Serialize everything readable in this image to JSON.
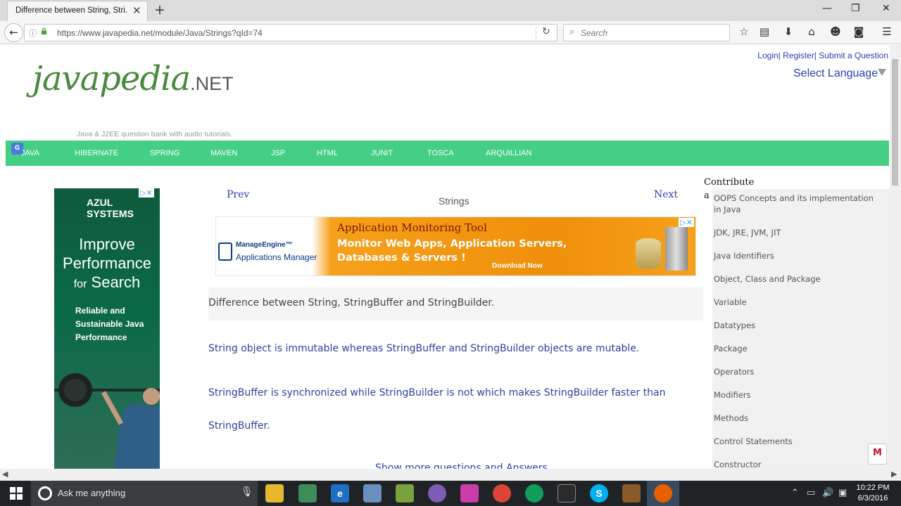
{
  "browser": {
    "tab_title": "Difference between String, Stri...",
    "url": "https://www.javapedia.net/module/Java/Strings?qId=74",
    "search_placeholder": "Search"
  },
  "header": {
    "auth_links": [
      "Login|",
      "Register|",
      "Submit a Question"
    ],
    "select_language": "Select Language",
    "logo_main": "javapedia",
    "logo_suffix": ".NET",
    "tagline": "Java & J2EE question bank with audio tutorials."
  },
  "menu": {
    "translate_badge": "G",
    "items": [
      "JAVA",
      "HIBERNATE",
      "SPRING",
      "MAVEN",
      "JSP",
      "HTML",
      "JUNIT",
      "TOSCA",
      "ARQUILLIAN"
    ]
  },
  "left_ad": {
    "brand": "AZUL SYSTEMS",
    "headline_1": "Improve",
    "headline_2": "Performance",
    "headline_for": "for",
    "headline_3": "Search",
    "subtext": "Reliable and Sustainable Java Performance",
    "ad_badge": "▷✕"
  },
  "content": {
    "prev": "Prev",
    "next": "Next",
    "topic": "Strings",
    "question": "Difference between String, StringBuffer and StringBuilder.",
    "answers": [
      "String object is immutable whereas StringBuffer and StringBuilder objects are mutable.",
      "StringBuffer is synchronized while StringBuilder is not which makes StringBuilder faster than",
      "StringBuffer."
    ],
    "show_more": "Show more questions and Answers"
  },
  "banner_ad": {
    "brand": "ManageEngine™",
    "product": "Applications Manager",
    "title": "Application Monitoring Tool",
    "line1": "Monitor Web Apps, Application Servers,",
    "line2": "Databases & Servers !",
    "cta": "Download Now",
    "close": "▷✕"
  },
  "sidebar": {
    "contribute_label": "Contribute",
    "contribute_suffix": "a",
    "items": [
      "OOPS Concepts and its implementation in Java",
      "JDK, JRE, JVM, JIT",
      "Java Identifiers",
      "Object, Class and Package",
      "Variable",
      "Datatypes",
      "Package",
      "Operators",
      "Modifiers",
      "Methods",
      "Control Statements",
      "Constructor"
    ]
  },
  "taskbar": {
    "search_placeholder": "Ask me anything",
    "time": "10:22 PM",
    "date": "6/3/2016"
  },
  "colors": {
    "menu_bar": "#44cf84",
    "link": "#2a3db0",
    "answer_text": "#2f3fa0"
  }
}
